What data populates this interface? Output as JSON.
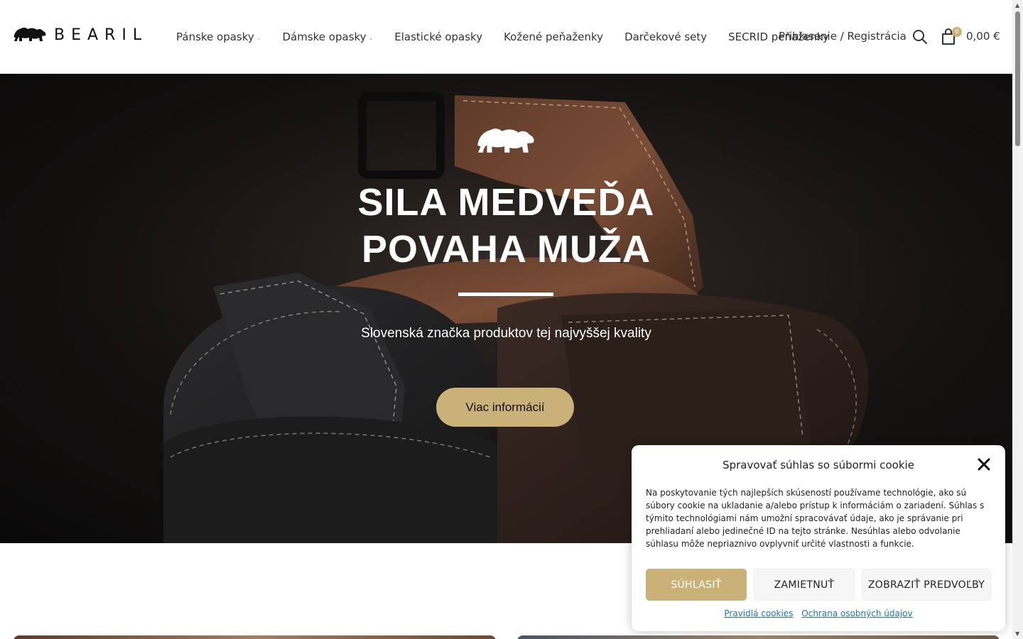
{
  "header": {
    "logo_text": "BEARIL",
    "nav": [
      {
        "label": "Pánske opasky",
        "dropdown": true
      },
      {
        "label": "Dámske opasky",
        "dropdown": true
      },
      {
        "label": "Elastické opasky",
        "dropdown": false
      },
      {
        "label": "Kožené peňaženky",
        "dropdown": false
      },
      {
        "label": "Darčekové sety",
        "dropdown": false
      },
      {
        "label": "SECRID peňaženky",
        "dropdown": false
      }
    ],
    "login_label": "Prihlasenie / Registrácia",
    "cart_count": "0",
    "cart_total": "0,00 €",
    "icons": {
      "search": "search-icon",
      "cart": "shopping-bag-icon",
      "dropdown": "chevron-down-icon"
    }
  },
  "hero": {
    "title_line1": "SILA MEDVEĎA",
    "title_line2": "POVAHA MUŽA",
    "subtitle": "Slovenská značka produktov tej najvyššej kvality",
    "button_label": "Viac informácií",
    "logo_icon": "bear-logo-icon"
  },
  "cookie_banner": {
    "title": "Spravovať súhlas so súbormi cookie",
    "text": "Na poskytovanie tých najlepších skúseností používame technológie, ako sú súbory cookie na ukladanie a/alebo prístup k informáciám o zariadení. Súhlas s týmito technológiami nám umožní spracovávať údaje, ako je správanie pri prehliadaní alebo jedinečné ID na tejto stránke. Nesúhlas alebo odvolanie súhlasu môže nepriaznivo ovplyvniť určité vlastnosti a funkcie.",
    "accept_label": "SÚHLASIŤ",
    "deny_label": "ZAMIETNUŤ",
    "prefs_label": "ZOBRAZIŤ PREDVOĽBY",
    "link_cookies": "Pravidlá cookies",
    "link_privacy": "Ochrana osobných údajov",
    "close_icon": "close-icon"
  },
  "colors": {
    "accent": "#c9b177",
    "hero_bg": "#151312",
    "link": "#1e73be"
  }
}
